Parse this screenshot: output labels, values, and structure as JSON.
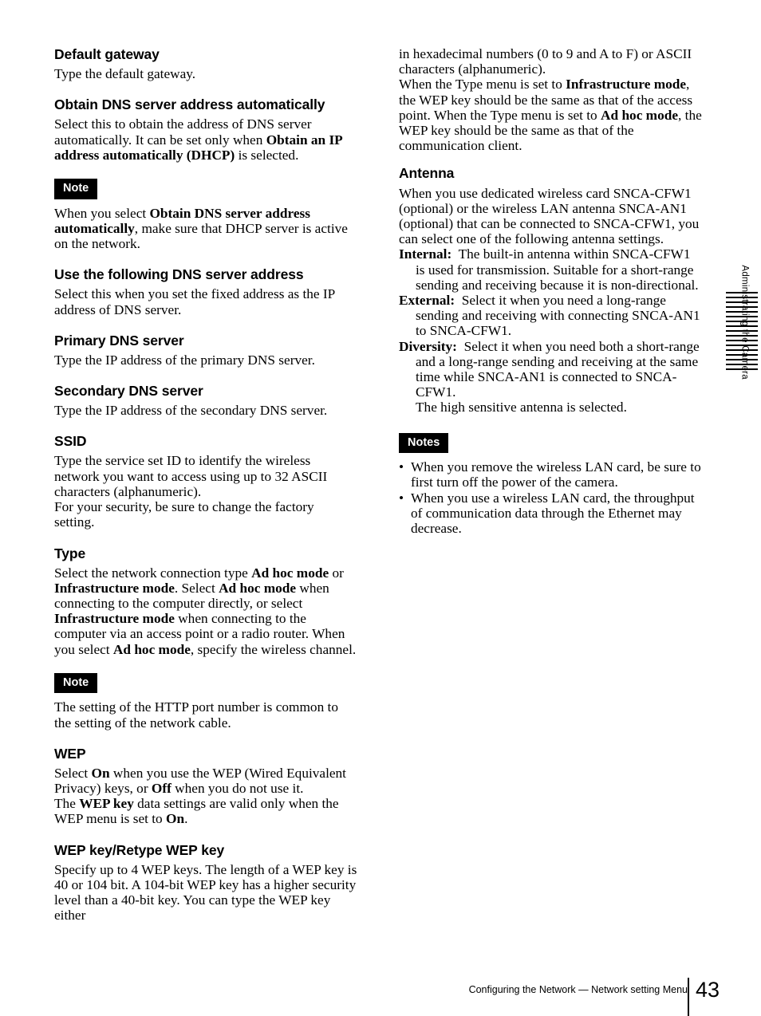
{
  "page": {
    "number": "43",
    "running_head": "Configuring the Network — Network setting Menu",
    "thumb_index_label": "Administrating the Camera",
    "thumb_index_stripe_count": 17
  },
  "left_column": {
    "sections": [
      {
        "heading": "Default gateway",
        "paragraphs": [
          "Type the default gateway."
        ]
      },
      {
        "heading": "Obtain DNS server address automatically",
        "paragraphs": [
          "Select this to obtain the address of DNS server automatically. It can be set only when <b>Obtain an IP address automatically (DHCP)</b> is selected."
        ],
        "note": {
          "badge": "Note",
          "body": "When you select <b>Obtain DNS server address automatically</b>, make sure that DHCP server is active on the network."
        }
      },
      {
        "heading": "Use the following DNS server address",
        "paragraphs": [
          "Select this when you set the fixed address as the IP address of DNS server."
        ]
      },
      {
        "heading": "Primary DNS server",
        "paragraphs": [
          "Type the IP address of the primary DNS server."
        ]
      },
      {
        "heading": "Secondary DNS server",
        "paragraphs": [
          "Type the IP address of the secondary DNS server."
        ]
      },
      {
        "heading": "SSID",
        "paragraphs": [
          "Type the service set ID to identify the wireless network you want to access using up to 32 ASCII characters (alphanumeric).",
          "For your security, be sure to change the factory setting."
        ]
      },
      {
        "heading": "Type",
        "paragraphs": [
          "Select the network connection type <b>Ad hoc mode</b> or <b>Infrastructure mode</b>. Select <b>Ad hoc mode</b> when connecting to the computer directly, or select <b>Infrastructure mode</b> when connecting to the computer via an access point or a radio router. When you select <b>Ad hoc mode</b>, specify the wireless channel."
        ],
        "note": {
          "badge": "Note",
          "body": "The setting of the HTTP port number is common to the setting of the network cable."
        }
      },
      {
        "heading": "WEP",
        "paragraphs": [
          "Select <b>On</b> when you use the WEP (Wired Equivalent Privacy) keys, or <b>Off</b> when you do not use it.",
          "The <b>WEP key</b> data settings are valid only when the WEP menu is set to <b>On</b>."
        ]
      },
      {
        "heading": "WEP key/Retype WEP key",
        "paragraphs": [
          "Specify up to 4 WEP keys.  The length of a WEP key is 40 or 104 bit.  A 104-bit WEP key has a higher security level than a 40-bit key.  You can type the WEP key either"
        ]
      }
    ]
  },
  "right_column": {
    "continuation": [
      "in hexadecimal numbers (0 to 9 and A to F) or ASCII characters (alphanumeric).",
      "When the Type menu is set to <b>Infrastructure mode</b>, the WEP key should be the same as that of the access point. When the Type menu is set to <b>Ad hoc mode</b>, the WEP key should be the same as that of the communication client."
    ],
    "antenna": {
      "heading": "Antenna",
      "intro": "When you use dedicated wireless card SNCA-CFW1 (optional) or the wireless LAN antenna SNCA-AN1 (optional) that can be connected to SNCA-CFW1, you can select one of the following antenna settings.",
      "definitions": [
        {
          "term": "Internal:",
          "definition": "The built-in antenna within SNCA-CFW1 is used for transmission. Suitable for a short-range sending and receiving because it is non-directional."
        },
        {
          "term": "External:",
          "definition": "Select it when you need a long-range sending and receiving with connecting SNCA-AN1 to SNCA-CFW1."
        },
        {
          "term": "Diversity:",
          "definition": "Select it when you need both a short-range and a long-range sending and receiving at the same time while SNCA-AN1 is connected to SNCA-CFW1.",
          "extra": "The high sensitive antenna is selected."
        }
      ]
    },
    "notes": {
      "badge": "Notes",
      "bullet": "•",
      "items": [
        "When you remove the wireless LAN card, be sure to first turn off the power of the camera.",
        "When you use a wireless LAN card, the throughput of communication data through the Ethernet may decrease."
      ]
    }
  }
}
